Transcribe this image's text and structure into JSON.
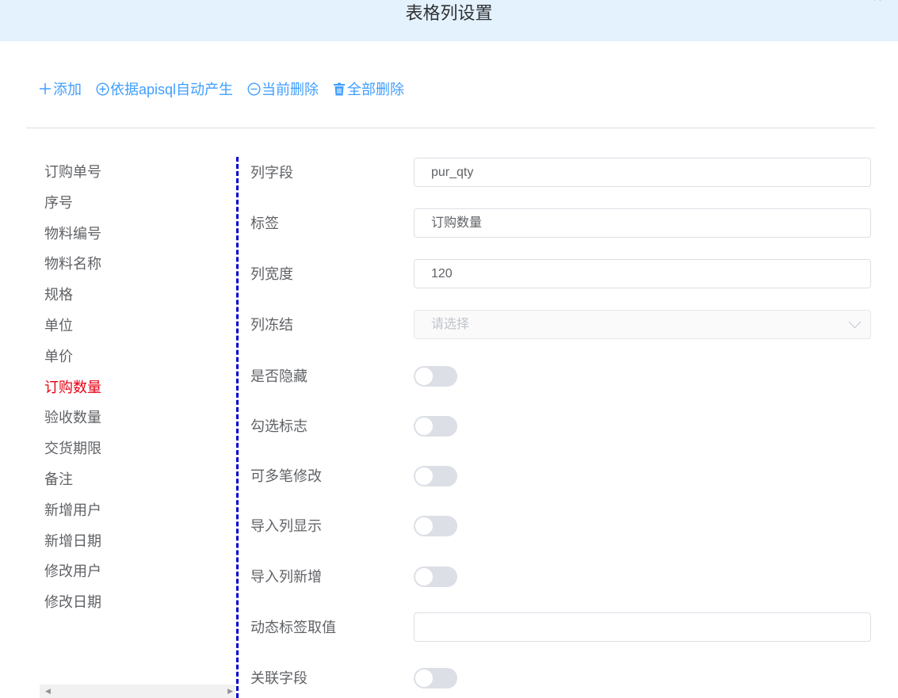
{
  "dialog": {
    "title": "表格列设置",
    "close_icon": "close-icon"
  },
  "toolbar": {
    "add_label": "添加",
    "auto_label": "依据apisql自动产生",
    "delete_current_label": "当前删除",
    "delete_all_label": "全部删除"
  },
  "columns": [
    "订购单号",
    "序号",
    "物料编号",
    "物料名称",
    "规格",
    "单位",
    "单价",
    "订购数量",
    "验收数量",
    "交货期限",
    "备注",
    "新增用户",
    "新增日期",
    "修改用户",
    "修改日期"
  ],
  "active_column": "订购数量",
  "form": {
    "field_label": "列字段",
    "field_value": "pur_qty",
    "tag_label": "标签",
    "tag_value": "订购数量",
    "width_label": "列宽度",
    "width_value": "120",
    "freeze_label": "列冻结",
    "freeze_placeholder": "请选择",
    "hidden_label": "是否隐藏",
    "hidden": false,
    "check_label": "勾选标志",
    "check": false,
    "multi_edit_label": "可多笔修改",
    "multi_edit": false,
    "import_show_label": "导入列显示",
    "import_show": false,
    "import_add_label": "导入列新增",
    "import_add": false,
    "dynamic_label": "动态标签取值",
    "dynamic_value": "",
    "related_label": "关联字段",
    "related": false
  },
  "colors": {
    "accent": "#409eff",
    "active_item": "#e60012",
    "header_bg": "#e3f2fd",
    "divider_line": "#0000cc"
  }
}
